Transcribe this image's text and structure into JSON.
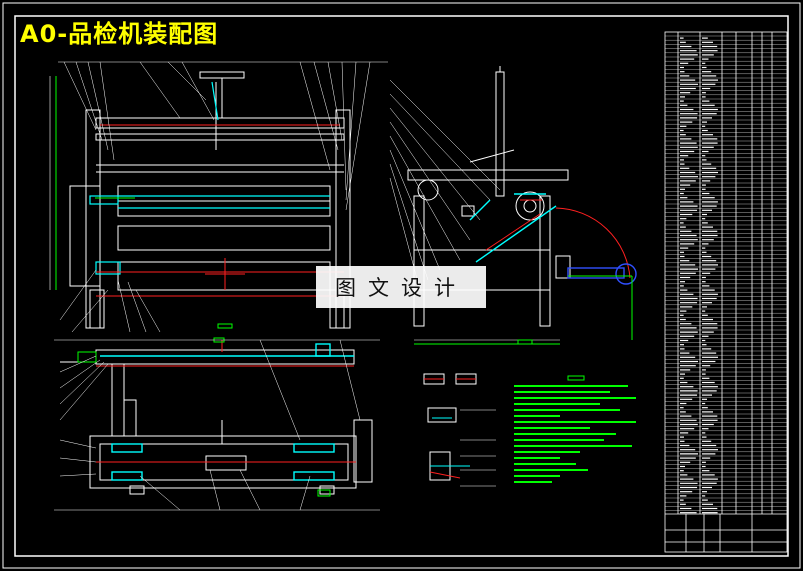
{
  "drawing": {
    "title": "A0-品检机装配图",
    "watermark": "图文设计"
  },
  "colors": {
    "background": "#000000",
    "line_white": "#ffffff",
    "line_cyan": "#00ffff",
    "line_red": "#ff2020",
    "line_green": "#00ff00",
    "line_yellow": "#ffff00",
    "line_blue": "#3050ff",
    "line_magenta": "#ff40ff"
  }
}
